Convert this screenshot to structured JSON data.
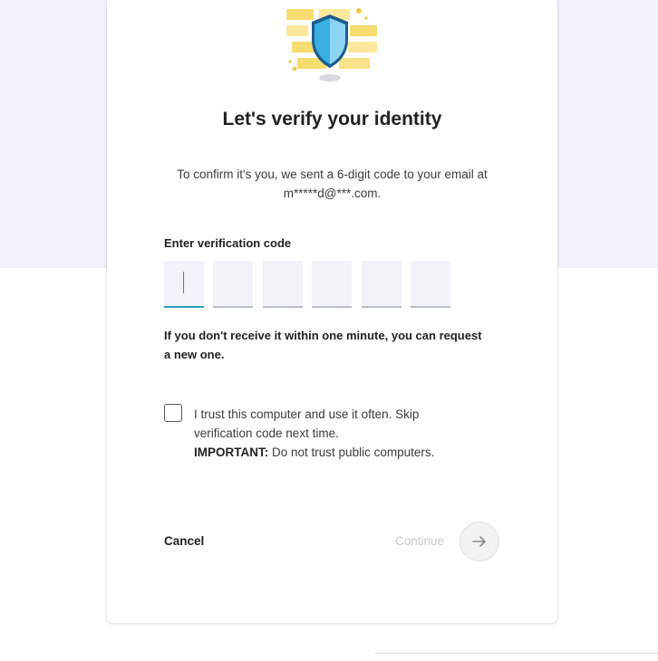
{
  "card": {
    "title": "Let's verify your identity",
    "description": "To confirm it's you, we sent a 6-digit code to your email at m*****d@***.com.",
    "code_label": "Enter verification code",
    "code_digits": [
      "",
      "",
      "",
      "",
      "",
      ""
    ],
    "resend_text": "If you don't receive it within one minute, you can request a new one.",
    "trust": {
      "text": "I trust this computer and use it often. Skip verification code next time.",
      "important_label": "IMPORTANT:",
      "important_text": "Do not trust public computers.",
      "checked": false
    },
    "cancel_label": "Cancel",
    "continue_label": "Continue"
  },
  "icons": {
    "hero": "shield-bricks-icon",
    "continue": "arrow-right-icon"
  },
  "colors": {
    "background_band": "#f1f2fc",
    "shield": "#3aaee0",
    "bricks": "#f7dc6f",
    "active_field_underline": "#2a9fb8",
    "disabled_text": "#c9c9c9"
  }
}
